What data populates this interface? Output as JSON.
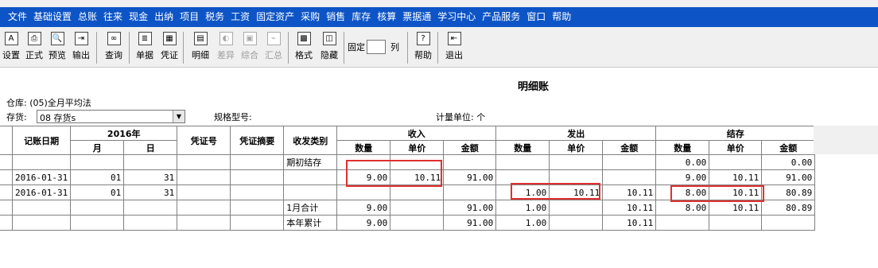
{
  "menu": [
    "文件",
    "基础设置",
    "总账",
    "往来",
    "现金",
    "出纳",
    "项目",
    "税务",
    "工资",
    "固定资产",
    "采购",
    "销售",
    "库存",
    "核算",
    "票据通",
    "学习中心",
    "产品服务",
    "窗口",
    "帮助"
  ],
  "toolbar": {
    "buttons": [
      {
        "label": "设置",
        "icon": "settings-icon",
        "glyph": "A",
        "enabled": true
      },
      {
        "label": "正式",
        "icon": "print-icon",
        "glyph": "⎙",
        "enabled": true
      },
      {
        "label": "预览",
        "icon": "preview-icon",
        "glyph": "🔍",
        "enabled": true
      },
      {
        "label": "输出",
        "icon": "export-icon",
        "glyph": "⇥",
        "enabled": true
      },
      {
        "label": "查询",
        "icon": "binoculars-icon",
        "glyph": "∞",
        "enabled": true
      },
      {
        "label": "单据",
        "icon": "document-icon",
        "glyph": "≣",
        "enabled": true
      },
      {
        "label": "凭证",
        "icon": "voucher-icon",
        "glyph": "▦",
        "enabled": true
      },
      {
        "label": "明细",
        "icon": "detail-icon",
        "glyph": "▤",
        "enabled": true
      },
      {
        "label": "差异",
        "icon": "difference-icon",
        "glyph": "◐",
        "enabled": false
      },
      {
        "label": "综合",
        "icon": "summary-icon",
        "glyph": "▣",
        "enabled": false
      },
      {
        "label": "汇总",
        "icon": "aggregate-icon",
        "glyph": "⌁",
        "enabled": false
      },
      {
        "label": "格式",
        "icon": "format-icon",
        "glyph": "▩",
        "enabled": true
      },
      {
        "label": "隐藏",
        "icon": "hide-icon",
        "glyph": "◫",
        "enabled": true
      },
      {
        "label": "帮助",
        "icon": "help-icon",
        "glyph": "?",
        "enabled": true
      },
      {
        "label": "退出",
        "icon": "exit-icon",
        "glyph": "⇤",
        "enabled": true
      }
    ],
    "fixed_label": "固定",
    "column_label": "列"
  },
  "report": {
    "title": "明细账",
    "warehouse_label": "仓库:",
    "warehouse_value": "(05)全月平均法",
    "inventory_label": "存货:",
    "inventory_value": "08 存货s",
    "spec_label": "规格型号:",
    "unit_label": "计量单位: 个"
  },
  "table": {
    "headers": {
      "date": "记账日期",
      "year": "2016年",
      "month": "月",
      "day": "日",
      "voucher_no": "凭证号",
      "voucher_summary": "凭证摘要",
      "category": "收发类别",
      "income": "收入",
      "issue": "发出",
      "balance": "结存",
      "qty": "数量",
      "price": "单价",
      "amount": "金额"
    },
    "rows": [
      [
        "",
        "",
        "",
        "",
        "",
        "期初结存",
        "",
        "",
        "",
        "",
        "",
        "",
        "0.00",
        "",
        "0.00"
      ],
      [
        "2016-01-31",
        "01",
        "31",
        "",
        "",
        "",
        "9.00",
        "10.11",
        "91.00",
        "",
        "",
        "",
        "9.00",
        "10.11",
        "91.00"
      ],
      [
        "2016-01-31",
        "01",
        "31",
        "",
        "",
        "",
        "",
        "",
        "",
        "1.00",
        "10.11",
        "10.11",
        "8.00",
        "10.11",
        "80.89"
      ],
      [
        "",
        "",
        "",
        "",
        "",
        "1月合计",
        "9.00",
        "",
        "91.00",
        "1.00",
        "",
        "10.11",
        "8.00",
        "10.11",
        "80.89"
      ],
      [
        "",
        "",
        "",
        "",
        "",
        "本年累计",
        "9.00",
        "",
        "91.00",
        "1.00",
        "",
        "10.11",
        "",
        "",
        ""
      ]
    ]
  },
  "colors": {
    "menubar_bg": "#0d54c6",
    "highlight": "#e03030"
  }
}
